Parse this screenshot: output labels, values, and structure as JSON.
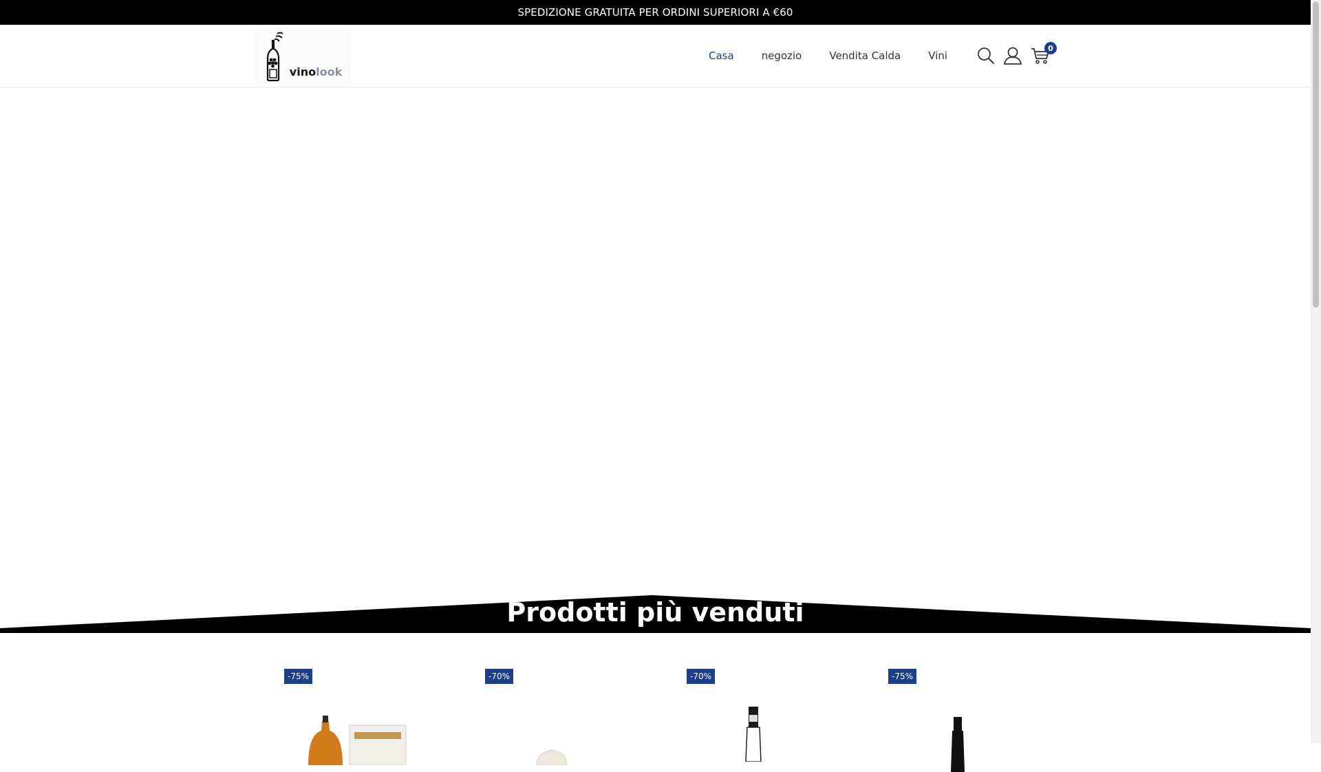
{
  "announcement": "SPEDIZIONE GRATUITA PER ORDINI SUPERIORI A €60",
  "logo": {
    "text_main": "vino",
    "text_dim": "look",
    "icon": "wine-bottle-icon"
  },
  "nav": {
    "items": [
      {
        "label": "Casa",
        "active": true
      },
      {
        "label": "negozio",
        "active": false
      },
      {
        "label": "Vendita Calda",
        "active": false
      },
      {
        "label": "Vini",
        "active": false
      }
    ]
  },
  "header_icons": {
    "search": "search-icon",
    "account": "user-icon",
    "cart": "cart-icon"
  },
  "cart": {
    "count": "0"
  },
  "section": {
    "title": "Prodotti più venduti"
  },
  "products": [
    {
      "discount": "-75%"
    },
    {
      "discount": "-70%"
    },
    {
      "discount": "-70%"
    },
    {
      "discount": "-75%"
    }
  ],
  "colors": {
    "accent": "#1b3f8b",
    "topbar": "#000000",
    "banner": "#000000"
  }
}
